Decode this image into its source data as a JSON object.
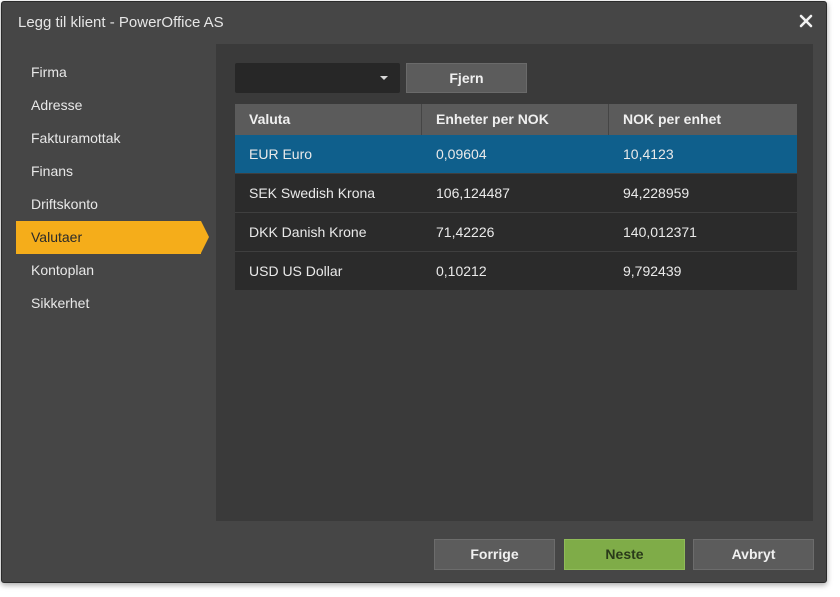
{
  "window": {
    "title": "Legg til klient - PowerOffice AS"
  },
  "sidebar": {
    "items": [
      {
        "label": "Firma"
      },
      {
        "label": "Adresse"
      },
      {
        "label": "Fakturamottak"
      },
      {
        "label": "Finans"
      },
      {
        "label": "Driftskonto"
      },
      {
        "label": "Valutaer",
        "active": true
      },
      {
        "label": "Kontoplan"
      },
      {
        "label": "Sikkerhet"
      }
    ]
  },
  "toolbar": {
    "select_value": "",
    "remove_label": "Fjern"
  },
  "table": {
    "headers": [
      "Valuta",
      "Enheter per NOK",
      "NOK per enhet"
    ],
    "rows": [
      [
        "EUR Euro",
        "0,09604",
        "10,4123"
      ],
      [
        "SEK Swedish Krona",
        "106,124487",
        "94,228959"
      ],
      [
        "DKK Danish Krone",
        "71,42226",
        "140,012371"
      ],
      [
        "USD US Dollar",
        "0,10212",
        "9,792439"
      ]
    ],
    "selected_row": 0
  },
  "footer": {
    "prev_label": "Forrige",
    "next_label": "Neste",
    "cancel_label": "Avbryt"
  },
  "colors": {
    "accent": "#f5ad1a",
    "selected_row": "#0f5f8c",
    "primary_button": "#7fac48"
  },
  "icons": {
    "close": "close-icon",
    "dropdown": "chevron-down-icon"
  }
}
